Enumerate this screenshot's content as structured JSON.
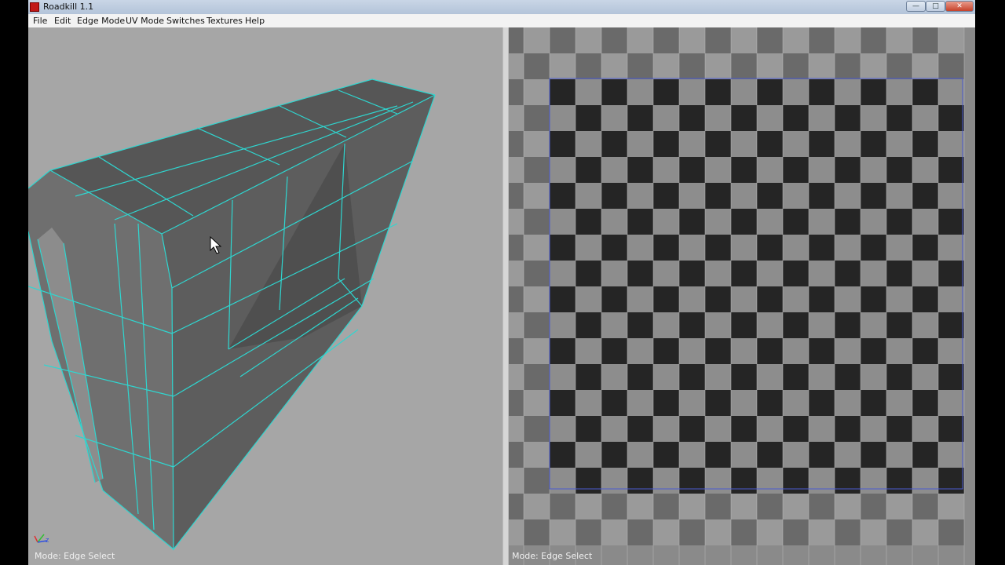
{
  "window": {
    "title": "Roadkill 1.1",
    "controls": {
      "minimize": "—",
      "maximize": "□",
      "close": "✕"
    }
  },
  "menu": {
    "items": [
      "File",
      "Edit",
      "Edge Mode",
      "UV Mode",
      "Switches",
      "Textures",
      "Help"
    ]
  },
  "viewport3d": {
    "status": "Mode: Edge Select",
    "axis_icon": "xyz-axis-gizmo-icon",
    "cursor_icon": "mouse-pointer-icon"
  },
  "viewport_uv": {
    "status": "Mode: Edge Select",
    "grid_columns": 18,
    "grid_rows": 20
  },
  "colors": {
    "wire": "#2fd6d0",
    "face": "#5a5a5a",
    "viewport_bg": "#a6a6a6",
    "checker_dark": "#252525",
    "checker_light": "#8d8d8d",
    "checker_out_dark": "#6a6a6a",
    "checker_out_light": "#9a9a9a",
    "uv_border": "#4a5bd0"
  }
}
